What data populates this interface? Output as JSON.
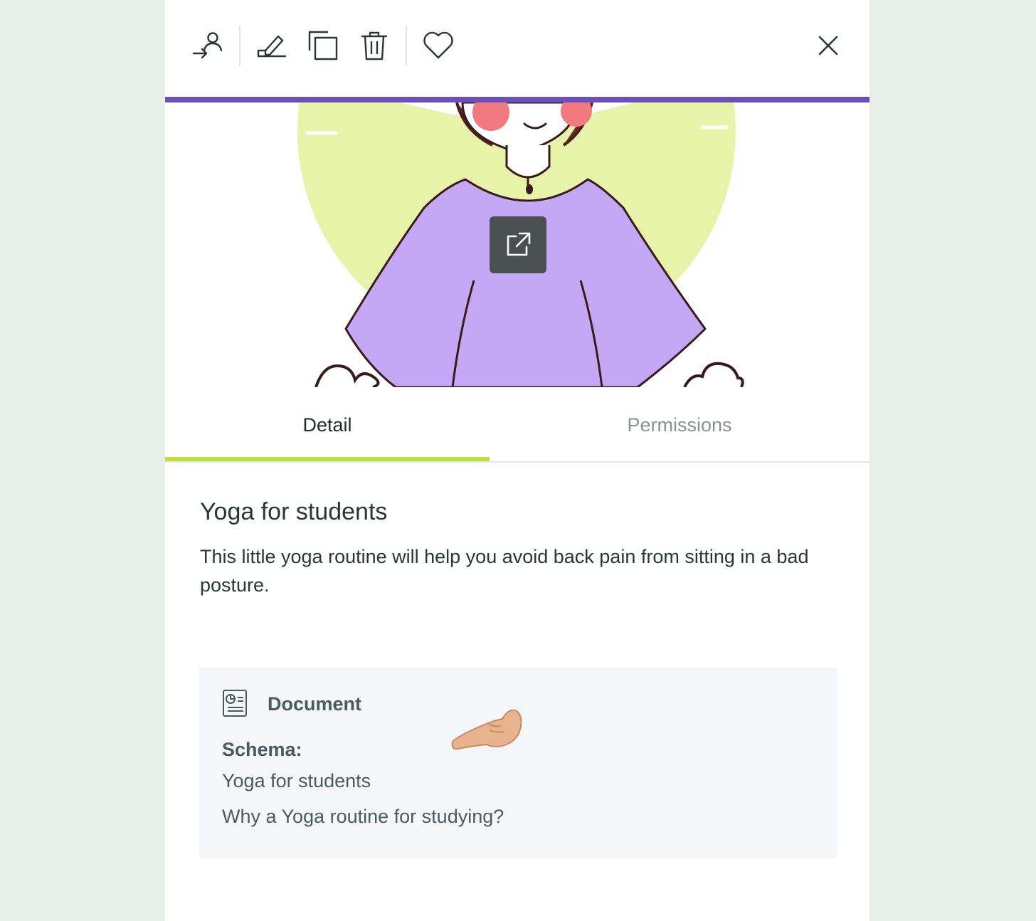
{
  "toolbar": {
    "icons": [
      "assign-user-icon",
      "sign-edit-icon",
      "duplicate-icon",
      "trash-icon",
      "heart-icon",
      "close-icon"
    ]
  },
  "hero": {
    "open_icon": "external-link-icon"
  },
  "tabs": [
    {
      "label": "Detail",
      "active": true
    },
    {
      "label": "Permissions",
      "active": false
    }
  ],
  "item": {
    "title": "Yoga for students",
    "description": "This little yoga routine will help you avoid back pain from sitting in a bad posture."
  },
  "document_card": {
    "type_label": "Document",
    "schema_label": "Schema:",
    "schema_items": [
      "Yoga for students",
      "Why a Yoga routine for studying?"
    ]
  },
  "colors": {
    "accent_bar": "#6a4fb8",
    "tab_underline": "#bfe03a",
    "background": "#e8eeea"
  }
}
